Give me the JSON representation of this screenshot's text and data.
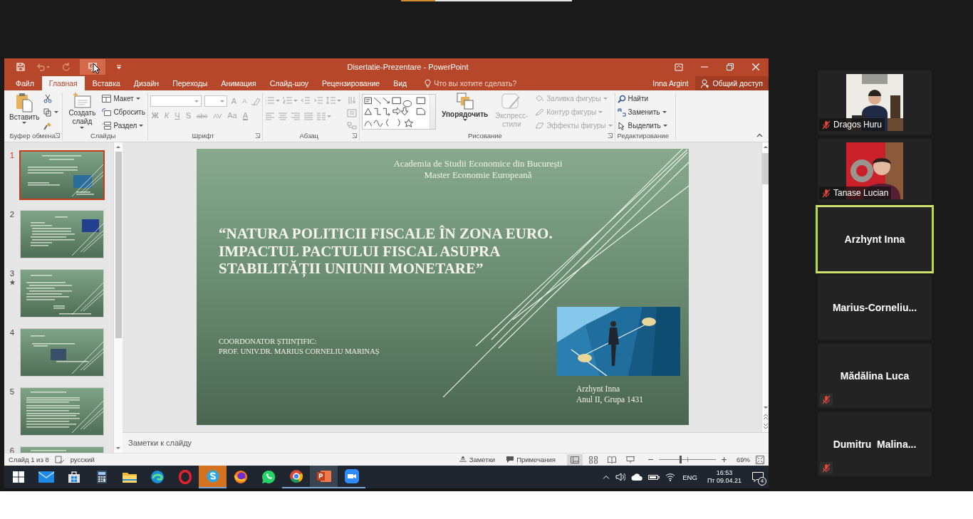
{
  "powerpoint": {
    "title": "Disertatie-Prezentare - PowerPoint",
    "quick_access": [
      {
        "kind": "save",
        "disabled": false,
        "highlighted": false
      },
      {
        "kind": "undo",
        "disabled": true,
        "highlighted": false
      },
      {
        "kind": "redo",
        "disabled": true,
        "highlighted": false
      },
      {
        "kind": "slideshow",
        "disabled": false,
        "highlighted": true
      },
      {
        "kind": "customize",
        "disabled": false,
        "highlighted": false
      }
    ],
    "tabs": [
      {
        "label": "Файл",
        "selected": false
      },
      {
        "label": "Главная",
        "selected": true
      },
      {
        "label": "Вставка",
        "selected": false
      },
      {
        "label": "Дизайн",
        "selected": false
      },
      {
        "label": "Переходы",
        "selected": false
      },
      {
        "label": "Анимация",
        "selected": false
      },
      {
        "label": "Слайд-шоу",
        "selected": false
      },
      {
        "label": "Рецензирование",
        "selected": false
      },
      {
        "label": "Вид",
        "selected": false
      }
    ],
    "tell_me": {
      "placeholder": "Что вы хотите сделать?"
    },
    "user": "Inna Argint",
    "share_button": "Общий доступ",
    "ribbon": {
      "clipboard": {
        "label": "Буфер обмена",
        "paste": "Вставить"
      },
      "slides": {
        "label": "Слайды",
        "new_slide": "Создать слайд",
        "layout": "Макет",
        "reset": "Сбросить",
        "section": "Раздел"
      },
      "font": {
        "label": "Шрифт",
        "disabled": true,
        "size_buttons": [
          "A",
          "A"
        ],
        "style_buttons": [
          "Ж",
          "К",
          "Ч",
          "S",
          "abc",
          "AV",
          "Aa",
          "A"
        ]
      },
      "paragraph": {
        "label": "Абзац",
        "disabled": true
      },
      "drawing": {
        "label": "Рисование",
        "arrange": "Упорядочить",
        "quick_styles": {
          "label": "Экспресс-стили",
          "disabled": true
        },
        "shape_options": [
          {
            "label": "Заливка фигуры",
            "disabled": true
          },
          {
            "label": "Контур фигуры",
            "disabled": true
          },
          {
            "label": "Эффекты фигуры",
            "disabled": true
          }
        ]
      },
      "editing": {
        "label": "Редактирование",
        "find": "Найти",
        "replace": "Заменить",
        "select": "Выделить"
      }
    },
    "thumbnails": [
      {
        "number": "1",
        "selected": true,
        "animated": false
      },
      {
        "number": "2",
        "selected": false,
        "animated": false
      },
      {
        "number": "3",
        "selected": false,
        "animated": true
      },
      {
        "number": "4",
        "selected": false,
        "animated": false
      },
      {
        "number": "5",
        "selected": false,
        "animated": false
      },
      {
        "number": "6",
        "selected": false,
        "animated": false
      }
    ],
    "slide": {
      "header_lines": [
        "Academia de Studii Economice din București",
        "Master Economie Europeană"
      ],
      "title_lines": [
        "“NATURA POLITICII FISCALE ÎN ZONA EURO.",
        "IMPACTUL PACTULUI FISCAL ASUPRA",
        "STABILITĂȚII UNIUNII MONETARE”"
      ],
      "coordinator_lines": [
        "COORDONATOR ȘTIINȚIFIC:",
        "PROF. UNIV.DR. MARIUS CORNELIU MARINAȘ"
      ],
      "author_lines": [
        "Arzhynt Inna",
        "Anul II, Grupa 1431"
      ]
    },
    "notes": {
      "placeholder": "Заметки к слайду"
    },
    "status_bar": {
      "slide_counter": "Слайд 1 из 8",
      "language": "русский",
      "notes_button": "Заметки",
      "comments_button": "Примечания",
      "views": [
        {
          "kind": "normal",
          "selected": true
        },
        {
          "kind": "sorter",
          "selected": false
        },
        {
          "kind": "reading",
          "selected": false
        },
        {
          "kind": "slideshow",
          "selected": false
        }
      ],
      "zoom": {
        "level": 0.37,
        "reading": "69%"
      }
    }
  },
  "taskbar": {
    "apps": [
      {
        "kind": "mail",
        "running": false,
        "active": false,
        "flashing": false
      },
      {
        "kind": "store",
        "running": false,
        "active": false,
        "flashing": false
      },
      {
        "kind": "calculator",
        "running": false,
        "active": false,
        "flashing": false
      },
      {
        "kind": "folder",
        "running": false,
        "active": false,
        "flashing": false
      },
      {
        "kind": "swirl",
        "running": false,
        "active": false,
        "flashing": false
      },
      {
        "kind": "ring",
        "running": false,
        "active": false,
        "flashing": false
      },
      {
        "kind": "chat",
        "running": true,
        "active": false,
        "flashing": true
      },
      {
        "kind": "globe",
        "running": false,
        "active": false,
        "flashing": false
      },
      {
        "kind": "phone",
        "running": false,
        "active": false,
        "flashing": false
      },
      {
        "kind": "segments",
        "running": true,
        "active": false,
        "flashing": false
      },
      {
        "kind": "presentation",
        "running": true,
        "active": true,
        "flashing": false
      },
      {
        "kind": "camera",
        "running": true,
        "active": false,
        "flashing": false
      }
    ],
    "tray": {
      "language": "ENG",
      "time": "16:53",
      "date": "Пт 09.04.21",
      "notifications": "4"
    }
  },
  "participants": [
    {
      "name": "Dragos Huru",
      "video": true,
      "muted": true,
      "speaking": false
    },
    {
      "name": "Tanase Lucian",
      "video": true,
      "muted": true,
      "speaking": false
    },
    {
      "name": "Arzhynt Inna",
      "video": false,
      "muted": false,
      "speaking": true
    },
    {
      "name": "Marius-Corneliu...",
      "video": false,
      "muted": false,
      "speaking": false
    },
    {
      "name": "Mădălina Luca",
      "video": false,
      "muted": true,
      "speaking": false
    },
    {
      "name": "Dumitru  Malina...",
      "video": false,
      "muted": true,
      "speaking": false
    }
  ]
}
